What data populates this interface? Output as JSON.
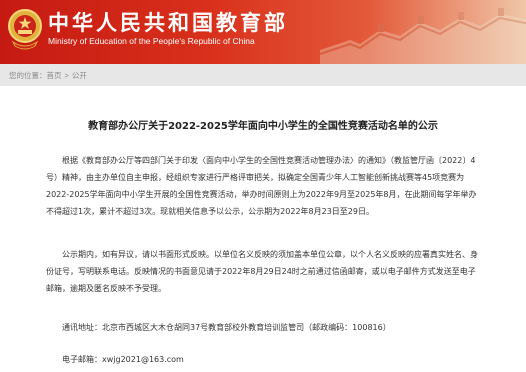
{
  "header": {
    "site_title": "中华人民共和国教育部",
    "site_subtitle": "Ministry of Education of the People's Republic of China"
  },
  "breadcrumb": {
    "prefix": "您的位置：",
    "home": "首页",
    "separator": ">",
    "current": "公开"
  },
  "article": {
    "title": "教育部办公厅关于2022-2025学年面向中小学生的全国性竞赛活动名单的公示",
    "paragraph_1": "根据《教育部办公厅等四部门关于印发〈面向中小学生的全国性竞赛活动管理办法〉的通知》（教监管厅函〔2022〕4号）精神，由主办单位自主申报，经组织专家进行严格评审把关，拟确定全国青少年人工智能创新挑战赛等45项竞赛为2022-2025学年面向中小学生开展的全国性竞赛活动，举办时间原则上为2022年9月至2025年8月，在此期间每学年举办不得超过1次，累计不超过3次。现就相关信息予以公示，公示期为2022年8月23日至29日。",
    "paragraph_2": "公示期内，如有异议，请以书面形式反映。以单位名义反映的须加盖本单位公章，以个人名义反映的应署真实姓名、身份证号，写明联系电话。反映情况的书面意见请于2022年8月29日24时之前通过信函邮寄，或以电子邮件方式发送至电子邮箱，逾期及匿名反映不予受理。",
    "address_label": "通讯地址：",
    "address": "北京市西城区大木仓胡同37号教育部校外教育培训监管司（邮政编码：100816）",
    "email_label": "电子邮箱：",
    "email": "xwjg2021@163.com"
  },
  "colors": {
    "header_red": "#c51a12",
    "breadcrumb_bg": "#e7e7e7",
    "body_text": "#333333"
  },
  "icons": [
    "national-emblem-icon",
    "great-wall-illustration"
  ]
}
